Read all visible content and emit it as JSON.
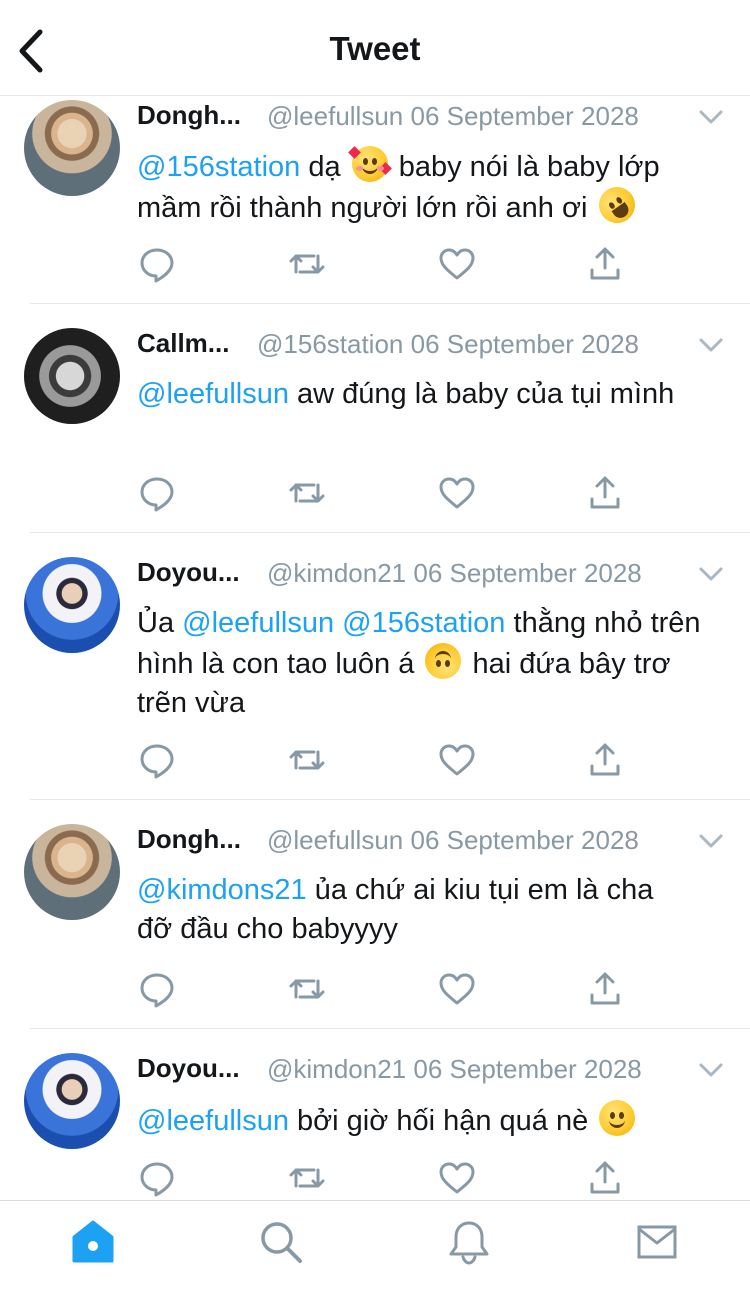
{
  "header": {
    "title": "Tweet"
  },
  "tweets": [
    {
      "name": "Dongh...",
      "handle": "@leefullsun",
      "date": "06 September 2028",
      "mention": "@156station",
      "text_a": " dạ ",
      "text_b": " baby nói là baby lớp mầm rồi thành người lớn rồi anh ơi ",
      "emoji_a": "smiling-face-with-hearts",
      "emoji_b": "rolling-on-floor-laughing"
    },
    {
      "name": "Callm...",
      "handle": "@156station",
      "date": "06 September 2028",
      "mention": "@leefullsun",
      "text_a": " aw đúng là baby của tụi mình"
    },
    {
      "name": "Doyou...",
      "handle": "@kimdon21",
      "date": "06 September 2028",
      "prefix": "Ủa ",
      "mention": "@leefullsun",
      "mention2": "@156station",
      "text_a": " thằng nhỏ trên hình là con tao luôn á ",
      "text_b": "  hai đứa bây trơ trẽn vừa",
      "emoji_a": "upside-down-face"
    },
    {
      "name": "Dongh...",
      "handle": "@leefullsun",
      "date": "06 September 2028",
      "mention": "@kimdons21",
      "text_a": " ủa chứ ai kiu tụi em là cha đỡ đầu cho babyyyy"
    },
    {
      "name": "Doyou...",
      "handle": "@kimdon21",
      "date": "06 September 2028",
      "mention": "@leefullsun",
      "text_a": " bởi giờ hối hận quá nè ",
      "emoji_a": "slightly-smiling-face"
    }
  ],
  "icons": {
    "back": "chevron-left-icon",
    "more": "chevron-down-icon",
    "reply": "reply-bubble-icon",
    "retweet": "retweet-icon",
    "like": "heart-icon",
    "share": "share-icon"
  },
  "tabbar": {
    "items": [
      "home-icon",
      "search-icon",
      "bell-icon",
      "mail-icon"
    ],
    "active": "home"
  },
  "colors": {
    "accent": "#1da1f2",
    "icon_gray": "#8899a6",
    "text": "#14171a",
    "divider": "#e1e8ed"
  }
}
